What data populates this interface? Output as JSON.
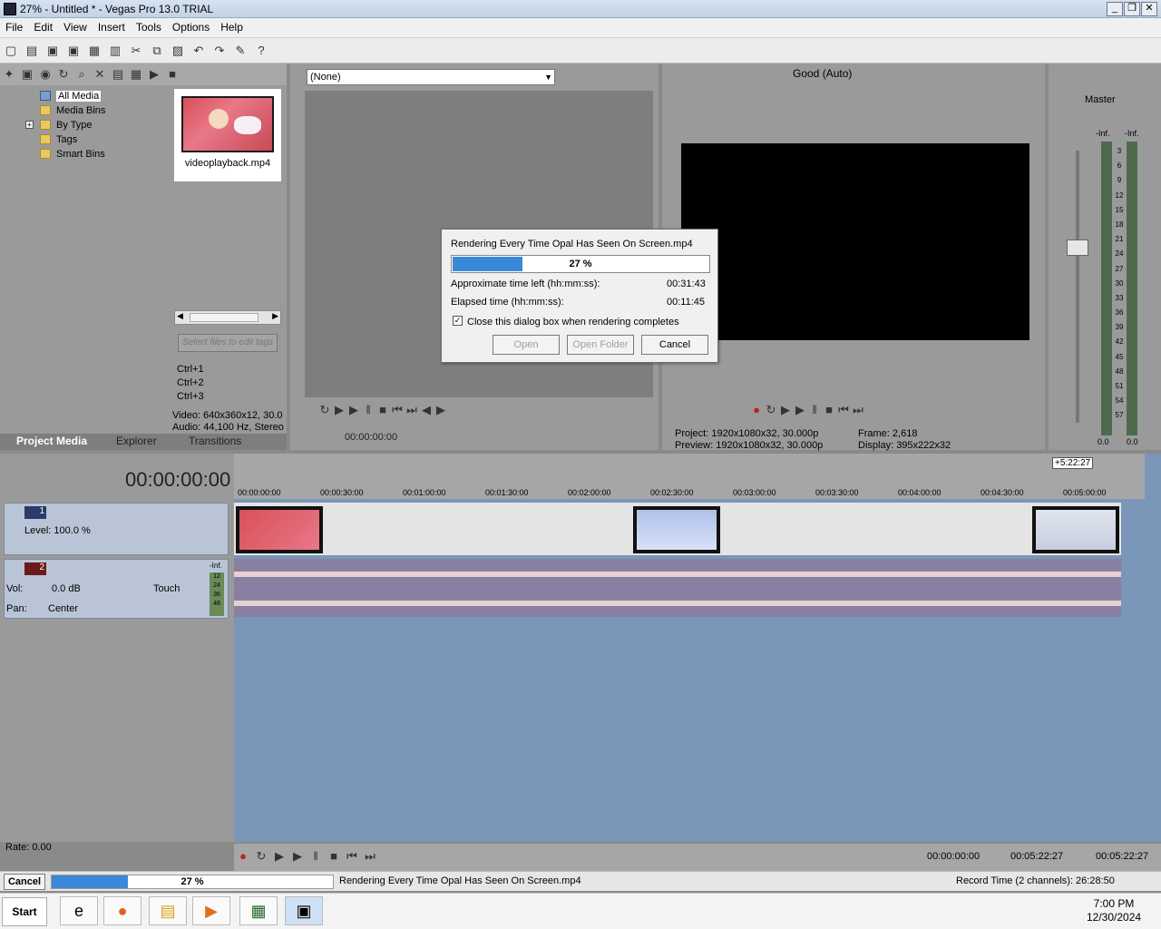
{
  "window": {
    "title": "27% - Untitled * - Vegas Pro 13.0 TRIAL",
    "min_icon": "minimize-icon",
    "max_icon": "restore-icon",
    "close_icon": "close-icon"
  },
  "menu": [
    "File",
    "Edit",
    "View",
    "Insert",
    "Tools",
    "Options",
    "Help"
  ],
  "project_media": {
    "tree": [
      "All Media",
      "Media Bins",
      "By Type",
      "Tags",
      "Smart Bins"
    ],
    "file_name": "videoplayback.mp4",
    "tag_placeholder": "Select files to edit tags",
    "shortcuts": [
      "Ctrl+1",
      "Ctrl+2",
      "Ctrl+3"
    ],
    "video_info": "Video: 640x360x12, 30.0",
    "audio_info": "Audio: 44,100 Hz, Stereo",
    "tabs": [
      "Project Media",
      "Explorer",
      "Transitions"
    ]
  },
  "trimmer": {
    "dropdown_value": "(None)",
    "timecode": "00:00:00:00"
  },
  "preview": {
    "quality": "Good (Auto)",
    "project_label": "Project:",
    "project_value": "1920x1080x32, 30.000p",
    "preview_label": "Preview:",
    "preview_value": "1920x1080x32, 30.000p",
    "frame_label": "Frame:",
    "frame_value": "2,618",
    "display_label": "Display:",
    "display_value": "395x222x32"
  },
  "master": {
    "label": "Master",
    "peak_left": "-Inf.",
    "peak_right": "-Inf.",
    "scale": [
      "3",
      "6",
      "9",
      "12",
      "15",
      "18",
      "21",
      "24",
      "27",
      "30",
      "33",
      "36",
      "39",
      "42",
      "45",
      "48",
      "51",
      "54",
      "57"
    ],
    "bottom_left": "0.0",
    "bottom_right": "0.0"
  },
  "timeline": {
    "cursor_time": "00:00:00:00",
    "end_marker": "+5:22:27",
    "ruler": [
      "00:00:00:00",
      "00:00:30:00",
      "00:01:00:00",
      "00:01:30:00",
      "00:02:00:00",
      "00:02:30:00",
      "00:03:00:00",
      "00:03:30:00",
      "00:04:00:00",
      "00:04:30:00",
      "00:05:00:00"
    ],
    "video_track": {
      "number": "1",
      "level": "Level: 100.0 %"
    },
    "audio_track": {
      "number": "2",
      "vol_label": "Vol:",
      "vol_value": "0.0 dB",
      "pan_label": "Pan:",
      "pan_value": "Center",
      "automation": "Touch",
      "meter_top": "-Inf.",
      "meter_scale": [
        "12",
        "24",
        "36",
        "48"
      ]
    },
    "rate": "Rate: 0.00"
  },
  "transport": {
    "time1": "00:00:00:00",
    "time2": "00:05:22:27",
    "time3": "00:05:22:27"
  },
  "dialog": {
    "title": "Rendering Every Time Opal Has Seen On Screen.mp4",
    "progress_text": "27 %",
    "progress": 0.27,
    "time_left_label": "Approximate time left (hh:mm:ss):",
    "time_left_value": "00:31:43",
    "elapsed_label": "Elapsed time (hh:mm:ss):",
    "elapsed_value": "00:11:45",
    "checkbox_label": "Close this dialog box when rendering completes",
    "checkbox_checked": true,
    "open": "Open",
    "open_folder": "Open Folder",
    "cancel": "Cancel"
  },
  "statusbar": {
    "cancel": "Cancel",
    "progress_text": "27 %",
    "progress": 0.27,
    "message": "Rendering Every Time Opal Has Seen On Screen.mp4",
    "record_time": "Record Time (2 channels): 26:28:50"
  },
  "taskbar": {
    "start": "Start",
    "time": "7:00 PM",
    "date": "12/30/2024",
    "apps": [
      "internet-explorer-icon",
      "firefox-icon",
      "file-explorer-icon",
      "media-player-icon",
      "computer-icon",
      "vegas-icon"
    ]
  },
  "colors": {
    "accent": "#3a88d8",
    "timeline_bg": "#7a96b8",
    "track_header": "#b9c5d6"
  }
}
